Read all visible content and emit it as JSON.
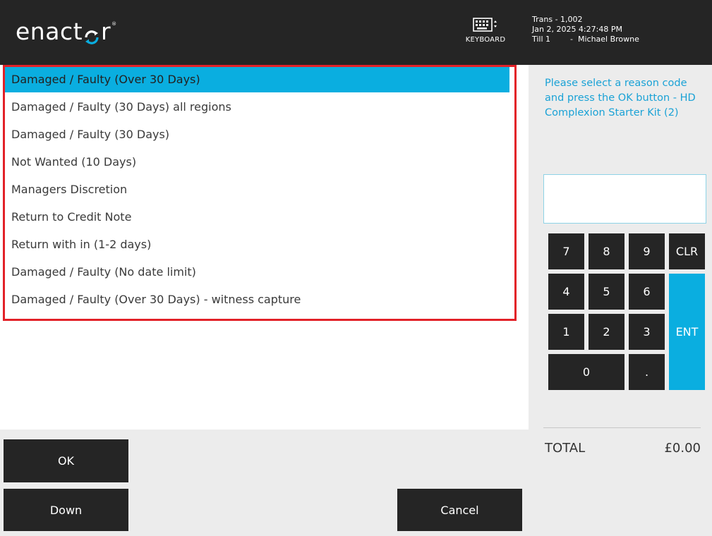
{
  "header": {
    "logo_text_left": "enact",
    "logo_text_right": "r",
    "logo_tm": "®",
    "keyboard_label": "KEYBOARD",
    "trans_line": "Trans - 1,002",
    "datetime": "Jan 2, 2025 4:27:48 PM",
    "till_line": "Till 1        -  Michael Browne"
  },
  "reason_list": {
    "selected_index": 0,
    "items": [
      "Damaged / Faulty (Over 30 Days)",
      "Damaged / Faulty (30 Days) all regions",
      "Damaged / Faulty (30 Days)",
      "Not Wanted (10 Days)",
      "Managers Discretion",
      "Return to Credit Note",
      "Return with in (1-2 days)",
      "Damaged / Faulty (No date limit)",
      "Damaged / Faulty (Over 30 Days) - witness capture"
    ]
  },
  "side": {
    "prompt": "Please select a reason code and press the OK button - HD Complexion Starter Kit (2)",
    "entry_value": ""
  },
  "keypad": {
    "k7": "7",
    "k8": "8",
    "k9": "9",
    "clr": "CLR",
    "k4": "4",
    "k5": "5",
    "k6": "6",
    "ent": "ENT",
    "k1": "1",
    "k2": "2",
    "k3": "3",
    "k0": "0",
    "dot": "."
  },
  "totals": {
    "label": "TOTAL",
    "value": "£0.00"
  },
  "buttons": {
    "ok": "OK",
    "down": "Down",
    "cancel": "Cancel"
  },
  "colors": {
    "accent": "#0aaee0",
    "header_bg": "#252525",
    "highlight_border": "#e22128",
    "prompt_text": "#1aa2d6"
  }
}
